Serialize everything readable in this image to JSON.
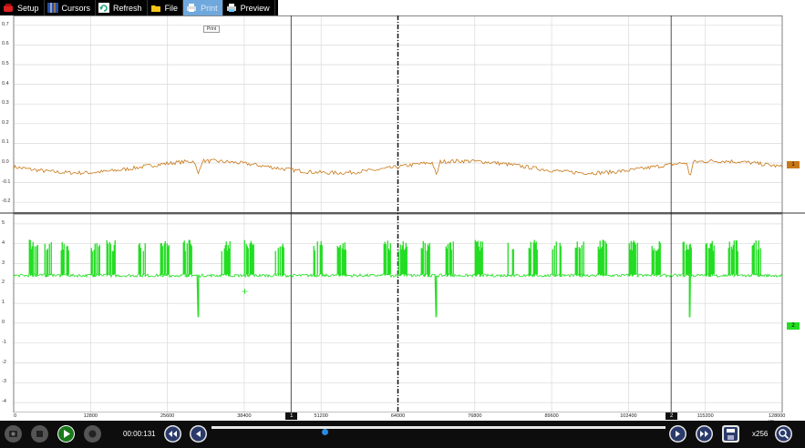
{
  "toolbar": {
    "items": [
      {
        "label": "Setup",
        "icon": "setup-icon"
      },
      {
        "label": "Cursors",
        "icon": "cursors-icon"
      },
      {
        "label": "Refresh",
        "icon": "refresh-icon"
      },
      {
        "label": "File",
        "icon": "folder-icon"
      },
      {
        "label": "Print",
        "icon": "print-icon",
        "active": true
      },
      {
        "label": "Preview",
        "icon": "preview-icon"
      }
    ],
    "tooltip": "Print"
  },
  "channel1": {
    "marker": "1",
    "color": "#c87818",
    "y_ticks": [
      "0.7",
      "0.6",
      "0.5",
      "0.4",
      "0.3",
      "0.2",
      "0.1",
      "0.0",
      "-0.1",
      "-0.2"
    ],
    "y_values": [
      0.7,
      0.6,
      0.5,
      0.4,
      0.3,
      0.2,
      0.1,
      0.0,
      -0.1,
      -0.2
    ]
  },
  "channel2": {
    "marker": "2",
    "color": "#22dd22",
    "y_ticks": [
      "5",
      "4",
      "3",
      "2",
      "1",
      "0",
      "-1",
      "-2",
      "-3",
      "-4"
    ],
    "y_values": [
      5,
      4,
      3,
      2,
      1,
      0,
      -1,
      -2,
      -3,
      -4
    ]
  },
  "xaxis": {
    "ticks": [
      "0",
      "12800",
      "25600",
      "38400",
      "51200",
      "64000",
      "76800",
      "89600",
      "102400",
      "115200",
      "128000 µs"
    ],
    "values": [
      0,
      12800,
      25600,
      38400,
      51200,
      64000,
      76800,
      89600,
      102400,
      115200,
      128000
    ],
    "cursor1": {
      "label": "1",
      "value": 46200
    },
    "cursor2": {
      "label": "2",
      "value": 109500
    },
    "trigger_value": 64000
  },
  "bottombar": {
    "time": "00:00:131",
    "zoom": "x256",
    "scrub_position": 0.25,
    "buttons": [
      "camera-icon",
      "stop-icon",
      "play-icon",
      "record-icon",
      "rewind-icon",
      "step-back-icon",
      "step-forward-icon",
      "fast-forward-icon",
      "save-icon",
      "zoom-icon"
    ]
  }
}
